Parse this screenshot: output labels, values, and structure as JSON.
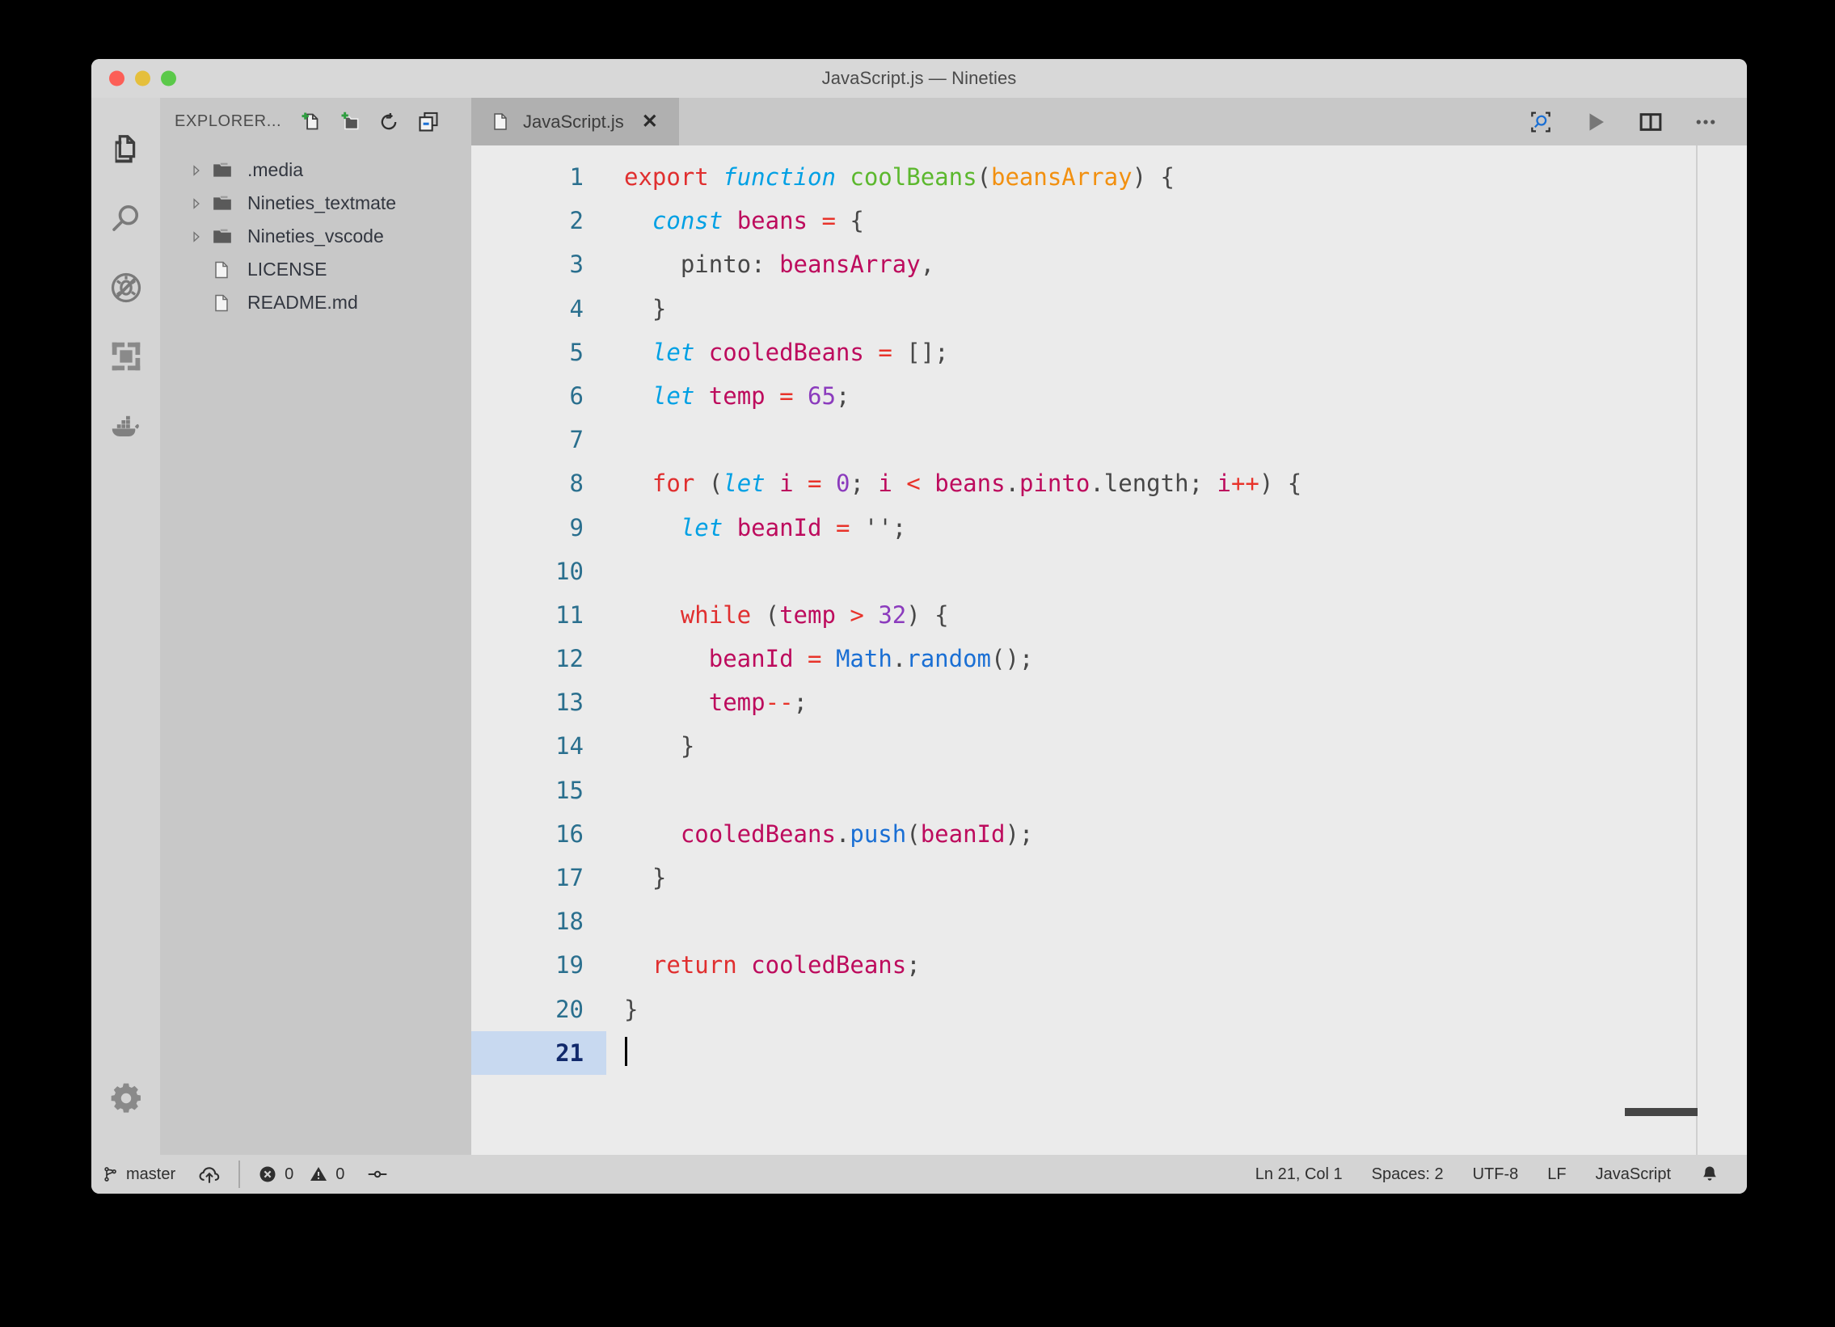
{
  "window": {
    "title": "JavaScript.js — Nineties"
  },
  "sidebar": {
    "title": "EXPLORER...",
    "actions": [
      "new-file",
      "new-folder",
      "refresh",
      "collapse-all"
    ],
    "tree": [
      {
        "name": ".media",
        "type": "folder",
        "expanded": false
      },
      {
        "name": "Nineties_textmate",
        "type": "folder",
        "expanded": false
      },
      {
        "name": "Nineties_vscode",
        "type": "folder",
        "expanded": false
      },
      {
        "name": "LICENSE",
        "type": "file"
      },
      {
        "name": "README.md",
        "type": "file"
      }
    ]
  },
  "activity_bar": {
    "items": [
      "files-icon",
      "search-icon",
      "debug-icon",
      "extensions-icon",
      "docker-icon"
    ],
    "bottom_items": [
      "gear-icon"
    ]
  },
  "editor": {
    "tab": {
      "label": "JavaScript.js",
      "close_glyph": "✕",
      "active": true
    },
    "actions": [
      "open-preview",
      "run",
      "split-editor",
      "more-actions"
    ],
    "line_numbers": [
      "1",
      "2",
      "3",
      "4",
      "5",
      "6",
      "7",
      "8",
      "9",
      "10",
      "11",
      "12",
      "13",
      "14",
      "15",
      "16",
      "17",
      "18",
      "19",
      "20",
      "21"
    ],
    "active_line": 21,
    "source_lines": [
      "export function coolBeans(beansArray) {",
      "  const beans = {",
      "    pinto: beansArray,",
      "  }",
      "  let cooledBeans = [];",
      "  let temp = 65;",
      "",
      "  for (let i = 0; i < beans.pinto.length; i++) {",
      "    let beanId = '';",
      "",
      "    while (temp > 32) {",
      "      beanId = Math.random();",
      "      temp--;",
      "    }",
      "",
      "    cooledBeans.push(beanId);",
      "  }",
      "",
      "  return cooledBeans;",
      "}",
      ""
    ],
    "tokens": {
      "sp": " ",
      "ind2": "  ",
      "ind4": "    ",
      "ind6": "      ",
      "l1": {
        "a": "export",
        "b": "function",
        "c": "coolBeans",
        "d": "(",
        "e": "beansArray",
        "f": ") {"
      },
      "l2": {
        "a": "const",
        "b": "beans",
        "c": "=",
        "d": " {"
      },
      "l3": {
        "a": "pinto: ",
        "b": "beansArray",
        "c": ","
      },
      "l4": {
        "a": "}"
      },
      "l5": {
        "a": "let",
        "b": "cooledBeans",
        "c": "=",
        "d": " [];"
      },
      "l6": {
        "a": "let",
        "b": "temp",
        "c": "=",
        "d": "65",
        "e": ";"
      },
      "l8": {
        "a": "for",
        "b": " (",
        "c": "let",
        "d": "i",
        "e": "=",
        "f": "0",
        "g": "; ",
        "h": "i",
        "i": "<",
        "j": "beans",
        "k": ".",
        "l": "pinto",
        "m": ".",
        "n": "length",
        "o": "; ",
        "p": "i",
        "q": "++",
        "r": ") {"
      },
      "l9": {
        "a": "let",
        "b": "beanId",
        "c": "=",
        "d": "''",
        "e": ";"
      },
      "l11": {
        "a": "while",
        "b": " (",
        "c": "temp",
        "d": ">",
        "e": "32",
        "f": ") {"
      },
      "l12": {
        "a": "beanId",
        "b": "=",
        "c": "Math",
        "d": ".",
        "e": "random",
        "f": "();"
      },
      "l13": {
        "a": "temp",
        "b": "--",
        "c": ";"
      },
      "l14": {
        "a": "}"
      },
      "l16": {
        "a": "cooledBeans",
        "b": ".",
        "c": "push",
        "d": "(",
        "e": "beanId",
        "f": ");"
      },
      "l17": {
        "a": "}"
      },
      "l19": {
        "a": "return",
        "b": "cooledBeans",
        "c": ";"
      },
      "l20": {
        "a": "}"
      }
    },
    "theme_colors": {
      "editor_background": "#ebebeb",
      "keyword": "#e02f2f",
      "declaration": "#00a0e4",
      "function_name": "#5cb82e",
      "parameter": "#f29010",
      "variable": "#bd0b5d",
      "operator": "#e8332a",
      "number": "#8b3bbd",
      "punctuation": "#474747",
      "method": "#1a6fd4",
      "line_number": "#2a6f8e",
      "active_line_background": "#c8d9f0",
      "active_line_number": "#11296b"
    }
  },
  "status_bar": {
    "branch": "master",
    "errors": "0",
    "warnings": "0",
    "cursor_position": "Ln 21, Col 1",
    "indentation": "Spaces: 2",
    "encoding": "UTF-8",
    "eol": "LF",
    "language": "JavaScript"
  }
}
